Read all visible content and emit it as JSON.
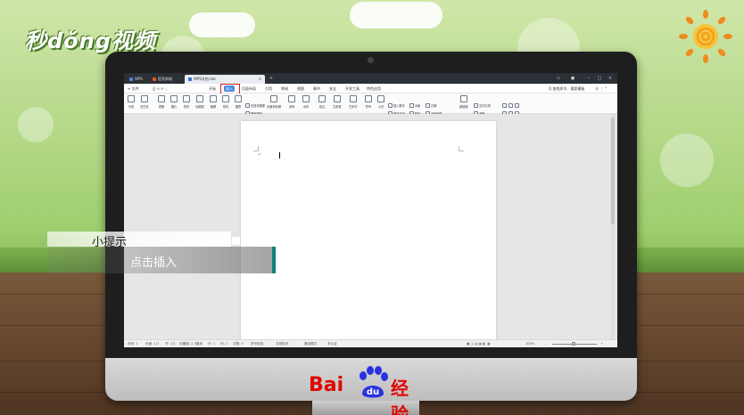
{
  "watermark": {
    "brand": "秒dǒng视频"
  },
  "tip": {
    "title": "小提示",
    "instruction": "点击插入"
  },
  "footer_logo": {
    "bai": "Bai",
    "du": "du",
    "jingyan": "经验"
  },
  "wps": {
    "tabs": [
      {
        "label": "WPS",
        "active": false
      },
      {
        "label": "稻壳商城",
        "active": false
      },
      {
        "label": "WPS文档.doc",
        "active": true
      }
    ],
    "menu": [
      "文件",
      "开始",
      "插入",
      "页面布局",
      "引用",
      "审阅",
      "视图",
      "章节",
      "安全",
      "开发工具",
      "特色应用"
    ],
    "menu_active": "插入",
    "search": "Q 查找命令、搜索模板",
    "toolbar": [
      "分页",
      "空白页",
      "表格",
      "图片",
      "形状",
      "功能图",
      "截屏",
      "形状",
      "图表",
      "在线流程图",
      "思维导图",
      "页眉和页脚",
      "页码",
      "水印",
      "批注",
      "文本框",
      "艺术字",
      "符号",
      "公式",
      "插入数字",
      "对象",
      "日期",
      "首字下沉",
      "附件",
      "文档部件",
      "超链接",
      "书签",
      "交叉引用"
    ],
    "status": {
      "page": "页码: 1",
      "pages": "页面: 1/1",
      "section": "节: 1/1",
      "setting": "设置值: 2.5厘米",
      "row": "行: 1",
      "col": "列: 1",
      "words": "字数: 0",
      "spell": "拼写检查",
      "doc_check": "文档校对",
      "compat": "兼容模式",
      "cert": "未认证",
      "zoom": "100%"
    }
  },
  "colors": {
    "accent": "#12817a",
    "menu_active": "#4b89dc",
    "highlight": "#e02020",
    "baidu_red": "#e10602",
    "baidu_blue": "#2932e1"
  }
}
